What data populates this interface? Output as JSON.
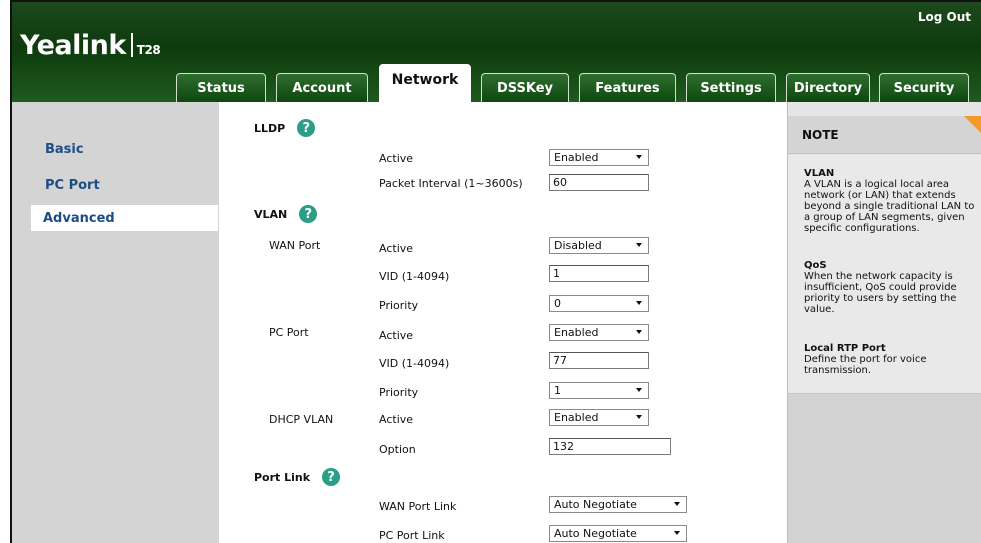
{
  "header": {
    "brand": "Yealink",
    "model": "T28",
    "logout": "Log Out"
  },
  "tabs": [
    {
      "label": "Status"
    },
    {
      "label": "Account"
    },
    {
      "label": "Network"
    },
    {
      "label": "DSSKey"
    },
    {
      "label": "Features"
    },
    {
      "label": "Settings"
    },
    {
      "label": "Directory"
    },
    {
      "label": "Security"
    }
  ],
  "active_tab": "Network",
  "sidebar": {
    "items": [
      {
        "label": "Basic"
      },
      {
        "label": "PC Port"
      },
      {
        "label": "Advanced"
      }
    ],
    "active": "Advanced"
  },
  "sections": {
    "lldp": {
      "title": "LLDP",
      "active_label": "Active",
      "active_value": "Enabled",
      "interval_label": "Packet Interval (1~3600s)",
      "interval_value": "60"
    },
    "vlan": {
      "title": "VLAN",
      "wan": {
        "group": "WAN Port",
        "active_label": "Active",
        "active_value": "Disabled",
        "vid_label": "VID (1-4094)",
        "vid_value": "1",
        "priority_label": "Priority",
        "priority_value": "0"
      },
      "pc": {
        "group": "PC Port",
        "active_label": "Active",
        "active_value": "Enabled",
        "vid_label": "VID (1-4094)",
        "vid_value": "77",
        "priority_label": "Priority",
        "priority_value": "1"
      },
      "dhcp": {
        "group": "DHCP VLAN",
        "active_label": "Active",
        "active_value": "Enabled",
        "option_label": "Option",
        "option_value": "132"
      }
    },
    "portlink": {
      "title": "Port Link",
      "wan_label": "WAN Port Link",
      "wan_value": "Auto Negotiate",
      "pc_label": "PC Port Link",
      "pc_value": "Auto Negotiate"
    }
  },
  "note": {
    "title": "NOTE",
    "items": [
      {
        "heading": "VLAN",
        "text": "A VLAN is a logical local area network (or LAN) that extends beyond a single traditional LAN to a group of LAN segments, given specific configurations."
      },
      {
        "heading": "QoS",
        "text": "When the network capacity is insufficient, QoS could provide priority to users by setting the value."
      },
      {
        "heading": "Local RTP Port",
        "text": "Define the port for voice transmission."
      }
    ]
  },
  "help_glyph": "?",
  "colors": {
    "header_green": "#0d3b0d",
    "help_teal": "#2a9e88",
    "sidebar_link": "#1c4d86",
    "note_corner": "#f39a2a"
  }
}
